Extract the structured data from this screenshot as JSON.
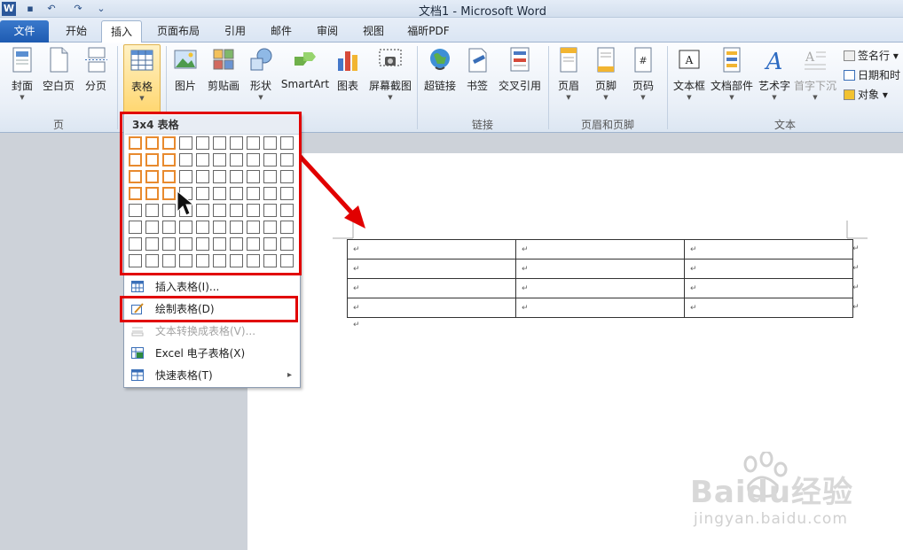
{
  "window": {
    "title": "文档1 - Microsoft Word"
  },
  "tabs": [
    {
      "label": "文件"
    },
    {
      "label": "开始"
    },
    {
      "label": "插入"
    },
    {
      "label": "页面布局"
    },
    {
      "label": "引用"
    },
    {
      "label": "邮件"
    },
    {
      "label": "审阅"
    },
    {
      "label": "视图"
    },
    {
      "label": "福昕PDF"
    }
  ],
  "ribbon": {
    "pages_group": {
      "label": "页",
      "cover": "封面",
      "blank": "空白页",
      "break": "分页"
    },
    "table_group": {
      "table": "表格"
    },
    "illustrations": {
      "picture": "图片",
      "clipart": "剪贴画",
      "shapes": "形状",
      "smartart": "SmartArt",
      "chart": "图表",
      "screenshot": "屏幕截图"
    },
    "links_group": {
      "label": "链接",
      "hyperlink": "超链接",
      "bookmark": "书签",
      "crossref": "交叉引用"
    },
    "header_footer_group": {
      "label": "页眉和页脚",
      "header": "页眉",
      "footer": "页脚",
      "pagenum": "页码"
    },
    "text_group": {
      "label": "文本",
      "textbox": "文本框",
      "quickparts": "文档部件",
      "wordart": "艺术字",
      "dropcap": "首字下沉",
      "signature": "签名行",
      "datetime": "日期和时",
      "object": "对象"
    }
  },
  "table_dropdown": {
    "header": "3x4 表格",
    "grid": {
      "columns": 10,
      "rows": 8,
      "selected_cols": 3,
      "selected_rows": 4
    },
    "items": [
      {
        "label": "插入表格(I)...",
        "disabled": false
      },
      {
        "label": "绘制表格(D)",
        "disabled": false
      },
      {
        "label": "文本转换成表格(V)...",
        "disabled": true
      },
      {
        "label": "Excel 电子表格(X)",
        "disabled": false
      },
      {
        "label": "快速表格(T)",
        "disabled": false
      }
    ],
    "submenu_arrow": "▸"
  },
  "document": {
    "table": {
      "rows": 4,
      "cols": 3,
      "cell_mark": "↵"
    },
    "paragraph_mark": "↵"
  },
  "watermark": {
    "brand": "Baidu经验",
    "url": "jingyan.baidu.com"
  },
  "colors": {
    "highlight_red": "#e10000",
    "grid_orange": "#e88a2e",
    "file_tab_blue": "#1e5bb1"
  }
}
